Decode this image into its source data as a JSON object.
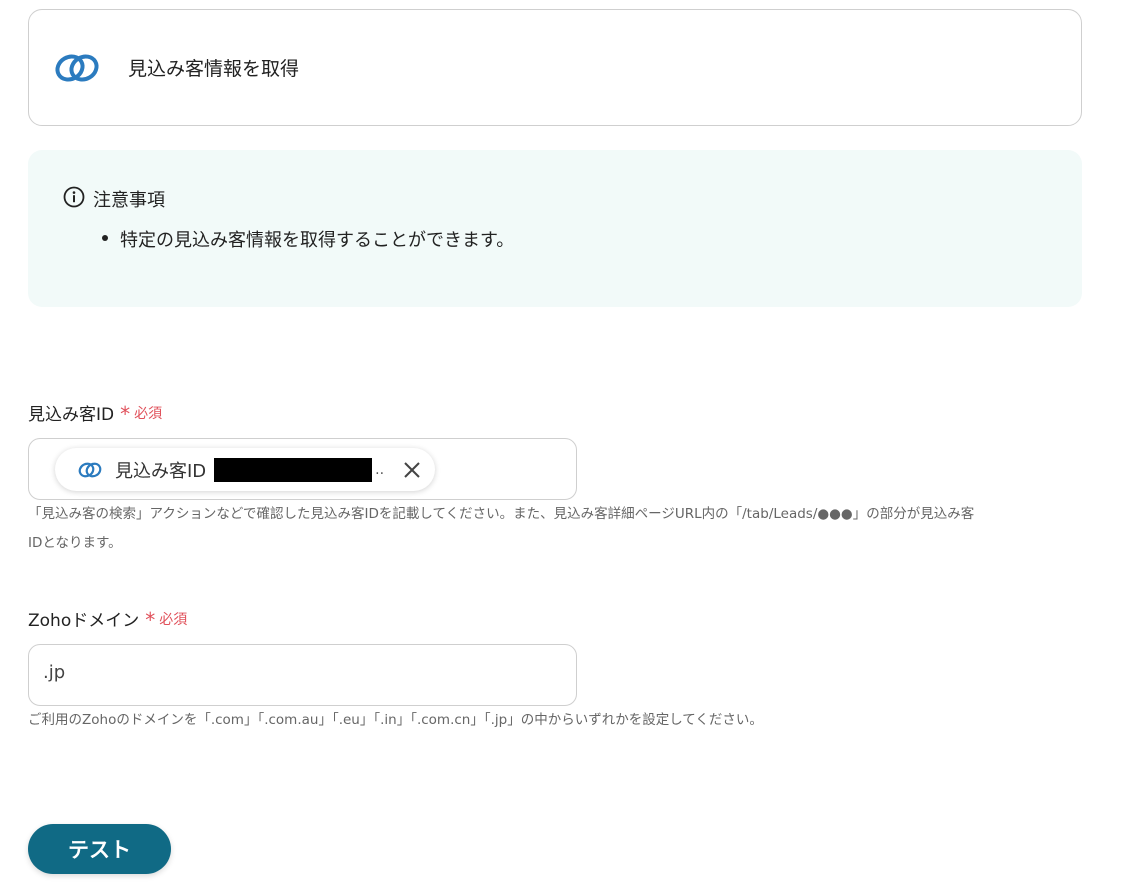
{
  "action_card": {
    "title": "見込み客情報を取得",
    "icon": "zoho-crm-link-icon"
  },
  "notice": {
    "icon": "info-circle-icon",
    "title": "注意事項",
    "items": [
      "特定の見込み客情報を取得することができます。"
    ]
  },
  "fields": {
    "lead_id": {
      "label": "見込み客ID",
      "required_mark": "*",
      "required_label": "必須",
      "chip_label": "見込み客ID",
      "chip_ellipsis": "..",
      "chip_icon": "zoho-crm-link-icon",
      "chip_close_icon": "close-icon",
      "help_line1": "「見込み客の検索」アクションなどで確認した見込み客IDを記載してください。また、見込み客詳細ページURL内の「/tab/Leads/●●●」の部分が見込み客",
      "help_line2": "IDとなります。"
    },
    "zoho_domain": {
      "label": "Zohoドメイン",
      "required_mark": "*",
      "required_label": "必須",
      "value": ".jp",
      "help": "ご利用のZohoのドメインを「.com」「.com.au」「.eu」「.in」「.com.cn」「.jp」の中からいずれかを設定してください。"
    }
  },
  "buttons": {
    "test_label": "テスト"
  },
  "colors": {
    "accent": "#106a85",
    "required": "#e0505a",
    "notice_bg": "#f2faf9",
    "icon_blue": "#2b7bbf"
  }
}
